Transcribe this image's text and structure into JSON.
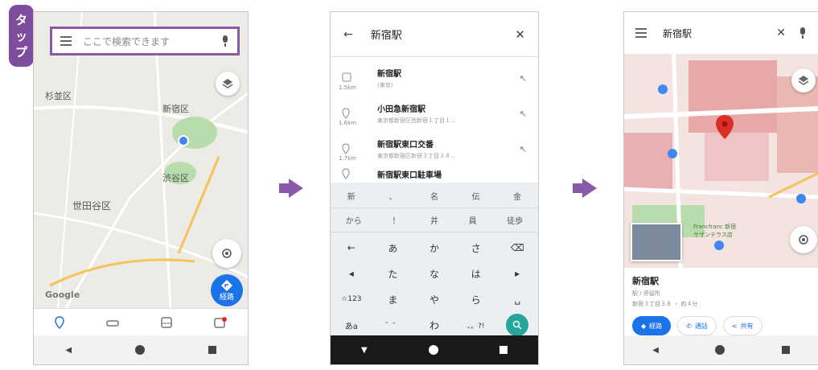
{
  "tap_badge": {
    "chars": [
      "タ",
      "ッ",
      "プ"
    ],
    "color": "#7e4d9e"
  },
  "screen1": {
    "search_placeholder": "ここで検索できます",
    "map_labels": [
      "杉並区",
      "新宿区",
      "渋谷区",
      "世田谷区"
    ],
    "google_logo": "Google",
    "route_button_label": "経路",
    "bottom_tab_icons": [
      "explore-pin-icon",
      "driving-car-icon",
      "transit-icon",
      "updates-icon"
    ]
  },
  "screen2": {
    "query": "新宿駅",
    "suggestions": [
      {
        "title": "新宿駅",
        "subtitle": "(東京)",
        "distance": "1.5km"
      },
      {
        "title": "小田急新宿駅",
        "subtitle": "東京都新宿区西新宿１丁目１...",
        "distance": "1.6km"
      },
      {
        "title": "新宿駅東口交番",
        "subtitle": "東京都新宿区新宿３丁目３８...",
        "distance": "1.7km"
      },
      {
        "title": "新宿駅東口駐車場",
        "subtitle": "",
        "distance": ""
      }
    ],
    "keyboard": {
      "candidates": [
        "新",
        "、",
        "名",
        "伝",
        "金"
      ],
      "candidates2": [
        "から",
        "！",
        "井",
        "員",
        "徒歩"
      ],
      "rows": [
        [
          "あ",
          "か",
          "さ"
        ],
        [
          "た",
          "な",
          "は"
        ],
        [
          "ま",
          "や",
          "ら"
        ],
        [
          "゛゜",
          "わ",
          "、。?!"
        ]
      ],
      "left_keys": [
        "←",
        "◂",
        "☆123",
        "あa"
      ]
    }
  },
  "screen3": {
    "title": "新宿駅",
    "place_name": "新宿駅",
    "place_type": "駅 / 停留所",
    "place_address": "新宿３丁目３８ ・ 約４分",
    "buttons": {
      "route": "経路",
      "call": "通話",
      "share": "共有"
    },
    "map_labels": [
      "Francfranc 新宿",
      "サザンテラス店"
    ]
  },
  "colors": {
    "accent_purple": "#8a5aa8",
    "maps_blue": "#1a73e8",
    "pin_red": "#d93025",
    "keyboard_green": "#26a69a"
  }
}
